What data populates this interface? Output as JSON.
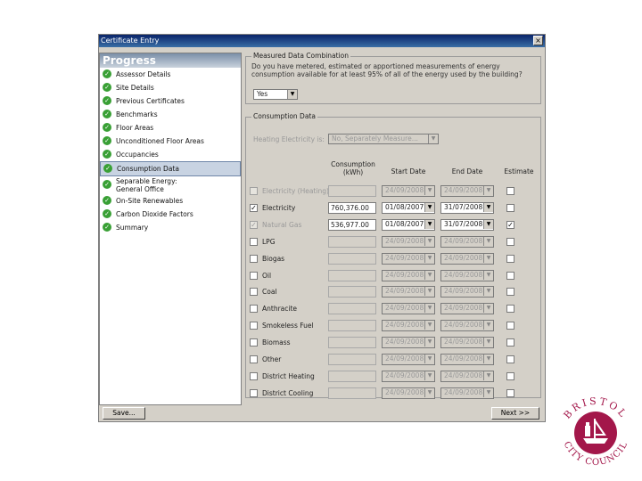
{
  "window": {
    "title": "Certificate Entry",
    "close_symbol": "×"
  },
  "progress": {
    "heading": "Progress",
    "steps": [
      {
        "label": "Assessor Details"
      },
      {
        "label": "Site Details"
      },
      {
        "label": "Previous Certificates"
      },
      {
        "label": "Benchmarks"
      },
      {
        "label": "Floor Areas"
      },
      {
        "label": "Unconditioned Floor Areas"
      },
      {
        "label": "Occupancies"
      },
      {
        "label": "Consumption Data",
        "selected": true
      },
      {
        "label": "Separable Energy:",
        "label2": "General Office"
      },
      {
        "label": "On-Site Renewables"
      },
      {
        "label": "Carbon Dioxide Factors"
      },
      {
        "label": "Summary"
      }
    ],
    "check_symbol": "✓"
  },
  "measured": {
    "legend": "Measured Data Combination",
    "question": "Do you have metered, estimated or apportioned measurements of energy consumption available for at least 95% of all of the energy used by the building?",
    "answer": "Yes"
  },
  "consumption": {
    "legend": "Consumption Data",
    "heating_label": "Heating Electricity is:",
    "heating_value": "No, Separately Measure...",
    "headers": {
      "consumption": "Consumption",
      "consumption_unit": "(kWh)",
      "start": "Start Date",
      "end": "End Date",
      "estimate": "Estimate"
    },
    "rows": [
      {
        "fuel": "Electricity (Heating)",
        "checked": false,
        "disabled": true,
        "value": "",
        "start": "24/09/2008",
        "end": "24/09/2008",
        "estimate": false
      },
      {
        "fuel": "Electricity",
        "checked": true,
        "disabled": false,
        "value": "760,376.00",
        "start": "01/08/2007",
        "end": "31/07/2008",
        "estimate": false
      },
      {
        "fuel": "Natural Gas",
        "checked": true,
        "disabled": true,
        "value": "536,977.00",
        "start": "01/08/2007",
        "end": "31/07/2008",
        "estimate": true
      },
      {
        "fuel": "LPG",
        "checked": false,
        "disabled": false,
        "value": "",
        "start": "24/09/2008",
        "end": "24/09/2008",
        "estimate": false
      },
      {
        "fuel": "Biogas",
        "checked": false,
        "disabled": false,
        "value": "",
        "start": "24/09/2008",
        "end": "24/09/2008",
        "estimate": false
      },
      {
        "fuel": "Oil",
        "checked": false,
        "disabled": false,
        "value": "",
        "start": "24/09/2008",
        "end": "24/09/2008",
        "estimate": false
      },
      {
        "fuel": "Coal",
        "checked": false,
        "disabled": false,
        "value": "",
        "start": "24/09/2008",
        "end": "24/09/2008",
        "estimate": false
      },
      {
        "fuel": "Anthracite",
        "checked": false,
        "disabled": false,
        "value": "",
        "start": "24/09/2008",
        "end": "24/09/2008",
        "estimate": false
      },
      {
        "fuel": "Smokeless Fuel",
        "checked": false,
        "disabled": false,
        "value": "",
        "start": "24/09/2008",
        "end": "24/09/2008",
        "estimate": false
      },
      {
        "fuel": "Biomass",
        "checked": false,
        "disabled": false,
        "value": "",
        "start": "24/09/2008",
        "end": "24/09/2008",
        "estimate": false
      },
      {
        "fuel": "Other",
        "checked": false,
        "disabled": false,
        "value": "",
        "start": "24/09/2008",
        "end": "24/09/2008",
        "estimate": false
      },
      {
        "fuel": "District Heating",
        "checked": false,
        "disabled": false,
        "value": "",
        "start": "24/09/2008",
        "end": "24/09/2008",
        "estimate": false
      },
      {
        "fuel": "District Cooling",
        "checked": false,
        "disabled": false,
        "value": "",
        "start": "24/09/2008",
        "end": "24/09/2008",
        "estimate": false
      }
    ],
    "dropdown_symbol": "▼",
    "tick_symbol": "✓"
  },
  "buttons": {
    "save": "Save...",
    "next": "Next >>"
  },
  "logo": {
    "top_text": "BRISTOL",
    "bottom_text": "CITY COUNCIL"
  },
  "colors": {
    "logo": "#a3174a",
    "check": "#39a035"
  }
}
